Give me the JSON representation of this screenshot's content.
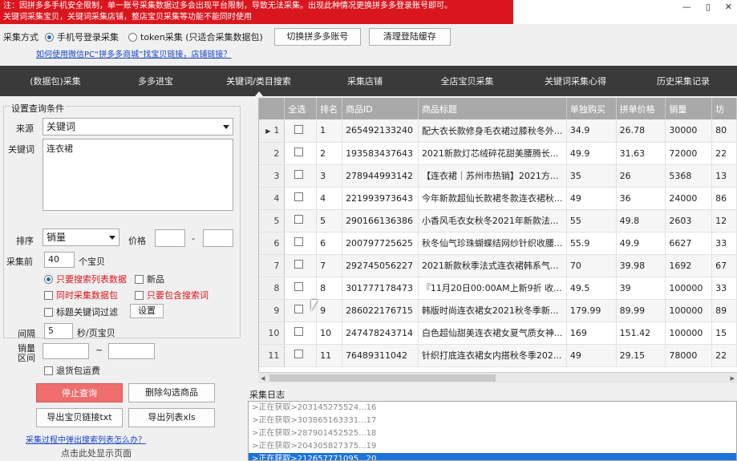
{
  "warning": {
    "line1": "注：因拼多多手机安全限制，单一账号采集数据过多会出现平台限制，导致无法采集。出现此种情况更换拼多多登录账号即可。",
    "line2": "关键词采集宝贝，关键词采集店铺，整店宝贝采集等功能不能同时使用"
  },
  "window_controls": {
    "minimize": "—",
    "maximize": "▯",
    "close": "✕"
  },
  "mode": {
    "label": "采集方式",
    "option1": "手机号登录采集",
    "option2": "token采集 (只适合采集数据包)",
    "switch_button": "切换拼多多账号",
    "clear_button": "清理登陆缓存",
    "help_link": "如何使用微信PC“拼多多商城”找宝贝链接，店铺链接？"
  },
  "nav": {
    "items": [
      "(数据包)采集",
      "多多进宝",
      "关键词/类目搜索",
      "采集店铺",
      "全店宝贝采集",
      "关键词采集心得",
      "历史采集记录"
    ],
    "active_index": 2
  },
  "form": {
    "group_title": "设置查询条件",
    "source_label": "来源",
    "source_value": "关键词",
    "keyword_label": "关键词",
    "keyword_value": "连衣裙",
    "sort_label": "排序",
    "sort_value": "销量",
    "price_label": "价格",
    "price_sep": "-",
    "collect_before_label": "采集前",
    "collect_before_value": "40",
    "collect_unit": "个宝贝",
    "opt_only_list": "只要搜索列表数据",
    "opt_new": "新品",
    "opt_with_pack": "同时采集数据包",
    "opt_only_keyword": "只要包含搜索词",
    "opt_title_filter": "标题关键词过滤",
    "settings_button": "设置",
    "interval_label": "间隔",
    "interval_value": "5",
    "interval_unit": "秒/页宝贝",
    "sales_range_label": "销量\n区间",
    "sales_sep": "~",
    "opt_refund_fee": "退货包运费",
    "stop_button": "停止查询",
    "delete_button": "删除勾选商品",
    "export_links_button": "导出宝贝链接txt",
    "export_list_button": "导出列表xls",
    "popup_link": "采集过程中弹出搜索列表怎么办？",
    "page_hint": "点击此处显示页面"
  },
  "table": {
    "headers": [
      "全选",
      "排名",
      "商品ID",
      "商品标题",
      "单独购买",
      "拼单价格",
      "销量",
      "坊"
    ],
    "rows": [
      {
        "rank": "1",
        "id": "265492133240",
        "title": "配大衣长款修身毛衣裙过膝秋冬外...",
        "single": "34.9",
        "group": "26.78",
        "sales": "30000",
        "extra": "80"
      },
      {
        "rank": "2",
        "id": "193583437643",
        "title": "2021新款灯芯绒碎花甜美腰腾长...",
        "single": "49.9",
        "group": "31.63",
        "sales": "72000",
        "extra": "22"
      },
      {
        "rank": "3",
        "id": "278944993142",
        "title": "【连衣裙｜苏州市热销】2021方...",
        "single": "35",
        "group": "26",
        "sales": "5368",
        "extra": "13"
      },
      {
        "rank": "4",
        "id": "221993973643",
        "title": "今年新款超仙长款裙冬款连衣裙秋...",
        "single": "49",
        "group": "36",
        "sales": "24000",
        "extra": "86"
      },
      {
        "rank": "5",
        "id": "290166136386",
        "title": "小香风毛衣女秋冬2021年新款法...",
        "single": "55",
        "group": "49.8",
        "sales": "2603",
        "extra": "12"
      },
      {
        "rank": "6",
        "id": "200797725625",
        "title": "秋冬仙气珍珠蝴蝶结网纱针织收腰...",
        "single": "55.9",
        "group": "49.9",
        "sales": "6627",
        "extra": "33"
      },
      {
        "rank": "7",
        "id": "292745056227",
        "title": "2021新款秋季法式连衣裙韩系气...",
        "single": "70",
        "group": "39.98",
        "sales": "1692",
        "extra": "67"
      },
      {
        "rank": "8",
        "id": "301777178473",
        "title": "『11月20日00:00AM上新9折 收...",
        "single": "49.5",
        "group": "39",
        "sales": "100000",
        "extra": "33"
      },
      {
        "rank": "9",
        "id": "286022176715",
        "title": "韩版时尚连衣裙女2021秋冬季新...",
        "single": "179.99",
        "group": "89.99",
        "sales": "100000",
        "extra": "89"
      },
      {
        "rank": "10",
        "id": "247478243714",
        "title": "白色超仙甜美连衣裙女夏气质女神...",
        "single": "169",
        "group": "151.42",
        "sales": "100000",
        "extra": "15"
      },
      {
        "rank": "11",
        "id": "76489311042",
        "title": "针织打底连衣裙女内搭秋冬季202...",
        "single": "49",
        "group": "29.15",
        "sales": "78000",
        "extra": "22"
      }
    ]
  },
  "log": {
    "title": "采集日志",
    "lines": [
      ">正在获取>203145275524...16",
      ">正在获取>303865163331...17",
      ">正在获取>287901452525...18",
      ">正在获取>204305827375...19",
      ">正在获取>212657771095...20"
    ]
  }
}
